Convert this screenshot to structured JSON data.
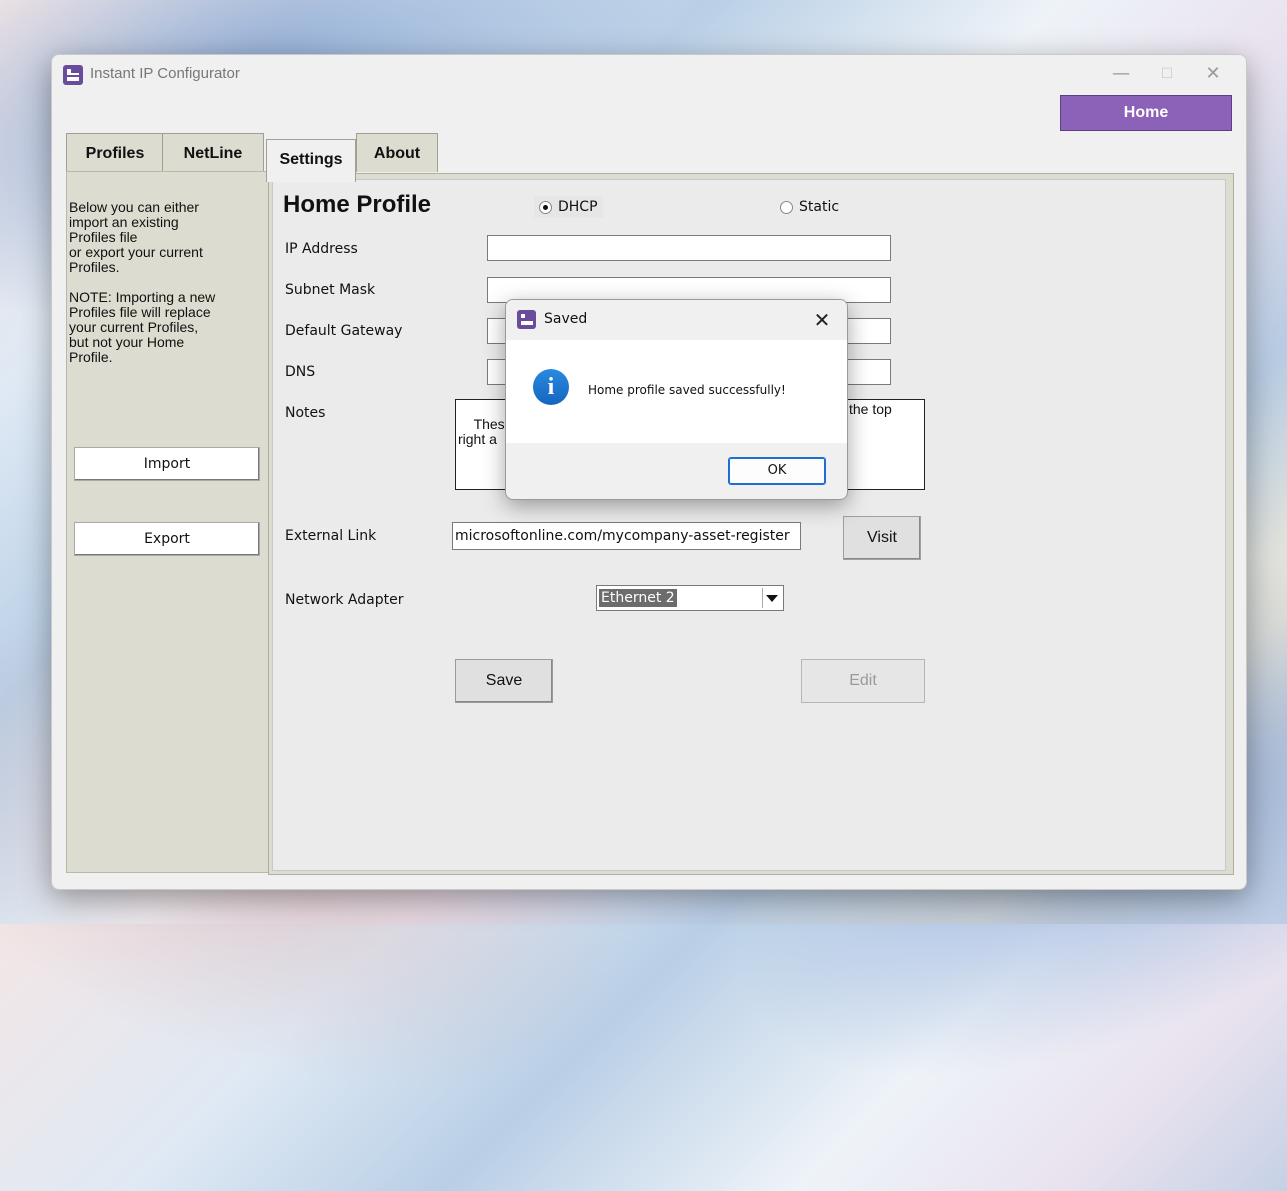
{
  "window": {
    "title": "Instant IP Configurator",
    "minimize": "—",
    "maximize": "☐",
    "close": "✕"
  },
  "header": {
    "home_button": "Home"
  },
  "tabs": [
    {
      "label": "Profiles"
    },
    {
      "label": "NetLine"
    },
    {
      "label": "Settings"
    },
    {
      "label": "About"
    }
  ],
  "sidebar": {
    "description": "Below you can either\nimport an existing\nProfiles file\nor export your current\nProfiles.\n\nNOTE: Importing a new\nProfiles file will replace\nyour current Profiles,\nbut not your Home\nProfile.",
    "import_label": "Import",
    "export_label": "Export"
  },
  "form": {
    "title": "Home Profile",
    "dhcp_label": "DHCP",
    "static_label": "Static",
    "ip_label": "IP Address",
    "subnet_label": "Subnet Mask",
    "gateway_label": "Default Gateway",
    "dns_label": "DNS",
    "notes_label": "Notes",
    "notes_value_line1": "These",
    "notes_value_line1_end": "the top",
    "notes_value_line2": "right a",
    "external_link_label": "External Link",
    "external_link_value": "microsoftonline.com/mycompany-asset-register",
    "visit_label": "Visit",
    "adapter_label": "Network Adapter",
    "adapter_value": "Ethernet 2",
    "save_label": "Save",
    "edit_label": "Edit"
  },
  "dialog": {
    "title": "Saved",
    "close": "✕",
    "icon": "info-icon",
    "message": "Home profile saved successfully!",
    "ok_label": "OK"
  },
  "colors": {
    "home_button": "#8c62b8",
    "info_icon": "#1e78d8",
    "ok_border": "#1c6fcf"
  }
}
